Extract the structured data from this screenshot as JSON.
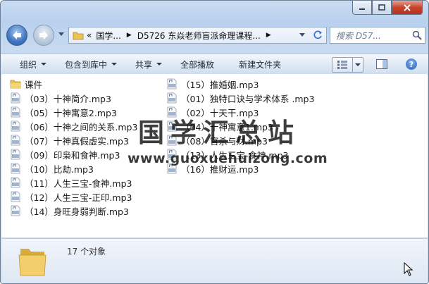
{
  "address": {
    "back_glyph": "«",
    "crumbs": [
      "国学...",
      "D5726 东焱老师盲派命理课程..."
    ]
  },
  "search": {
    "placeholder": "搜索 D57..."
  },
  "toolbar": {
    "organize": "组织",
    "include_in_library": "包含到库中",
    "share": "共享",
    "play_all": "全部播放",
    "new_folder": "新建文件夹"
  },
  "files": {
    "left": [
      {
        "name": "课件",
        "type": "folder"
      },
      {
        "name": "（03）十神简介.mp3",
        "type": "mp3"
      },
      {
        "name": "（05）十神寓意2.mp3",
        "type": "mp3"
      },
      {
        "name": "（06）十神之间的关系.mp3",
        "type": "mp3"
      },
      {
        "name": "（07）十神真假虚实.mp3",
        "type": "mp3"
      },
      {
        "name": "（09）印枭和食神.mp3",
        "type": "mp3"
      },
      {
        "name": "（10）比劫.mp3",
        "type": "mp3"
      },
      {
        "name": "（11）人生三宝-食神.mp3",
        "type": "mp3"
      },
      {
        "name": "（12）人生三宝-正印.mp3",
        "type": "mp3"
      },
      {
        "name": "（14）身旺身弱判断.mp3",
        "type": "mp3"
      }
    ],
    "right": [
      {
        "name": "（15）推婚姻.mp3",
        "type": "mp3"
      },
      {
        "name": "（01）独特口诀与学术体系 .mp3",
        "type": "mp3"
      },
      {
        "name": "（02）十天干.mp3",
        "type": "mp3"
      },
      {
        "name": "（04）十神寓意1.mp3",
        "type": "mp3"
      },
      {
        "name": "（08）官杀与财.mp3",
        "type": "mp3"
      },
      {
        "name": "（13）人生三宝-食神.mp3",
        "type": "mp3"
      },
      {
        "name": "（16）推财运.mp3",
        "type": "mp3"
      }
    ]
  },
  "watermark": {
    "title": "国学汇总站",
    "url": "www.guoxuehuizong.com"
  },
  "status": {
    "count": "17 个对象"
  },
  "icons": {
    "back": "back-arrow-icon",
    "forward": "forward-arrow-icon",
    "folder": "folder-icon",
    "mp3": "mp3-file-icon",
    "refresh": "refresh-icon",
    "search": "search-icon",
    "views": "view-icon",
    "preview_pane": "preview-pane-icon",
    "help": "help-icon"
  },
  "colors": {
    "accent": "#3f74c0",
    "frame": "#c2d6ef",
    "folder": "#e9c35a"
  }
}
